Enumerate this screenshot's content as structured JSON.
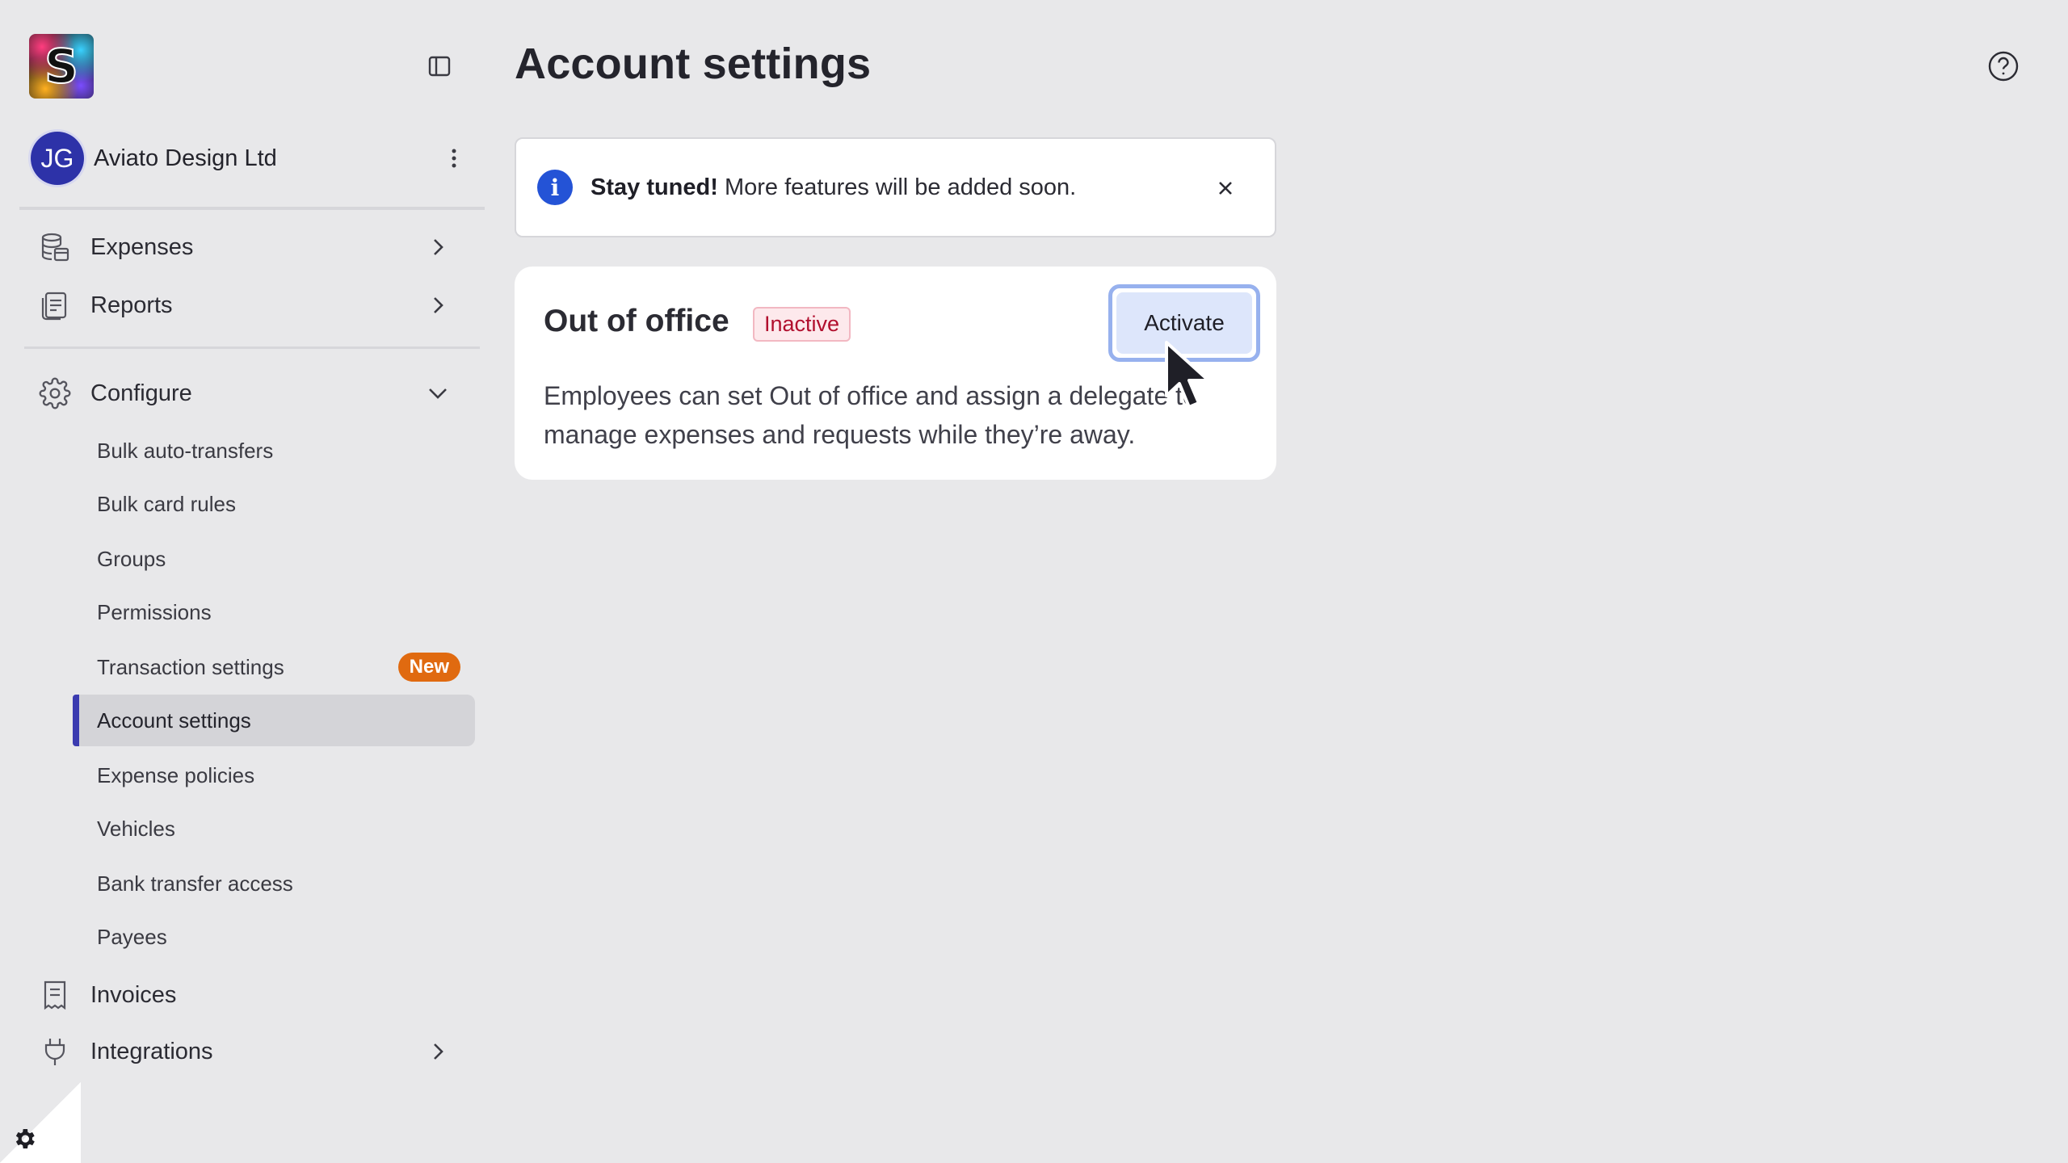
{
  "brand": {
    "logo_letter": "S"
  },
  "org": {
    "initials": "JG",
    "name": "Aviato Design Ltd"
  },
  "nav": {
    "expenses": "Expenses",
    "reports": "Reports",
    "configure": "Configure",
    "invoices": "Invoices",
    "integrations": "Integrations"
  },
  "configure_items": [
    "Bulk auto-transfers",
    "Bulk card rules",
    "Groups",
    "Permissions",
    "Transaction settings",
    "Account settings",
    "Expense policies",
    "Vehicles",
    "Bank transfer access",
    "Payees"
  ],
  "badges": {
    "new": "New"
  },
  "page": {
    "title": "Account settings"
  },
  "banner": {
    "bold": "Stay tuned!",
    "text": " More features will be added soon."
  },
  "out_of_office": {
    "title": "Out of office",
    "status": "Inactive",
    "action": "Activate",
    "description": "Employees can set Out of office and assign a delegate to manage expenses and requests while they’re away."
  },
  "icons": {
    "help": "help-circle-icon",
    "info": "info-icon",
    "close": "close-icon"
  },
  "colors": {
    "accent": "#3b3bb0",
    "new_badge": "#e06a10",
    "inactive_text": "#b10f2e",
    "info_blue": "#2453d6"
  }
}
